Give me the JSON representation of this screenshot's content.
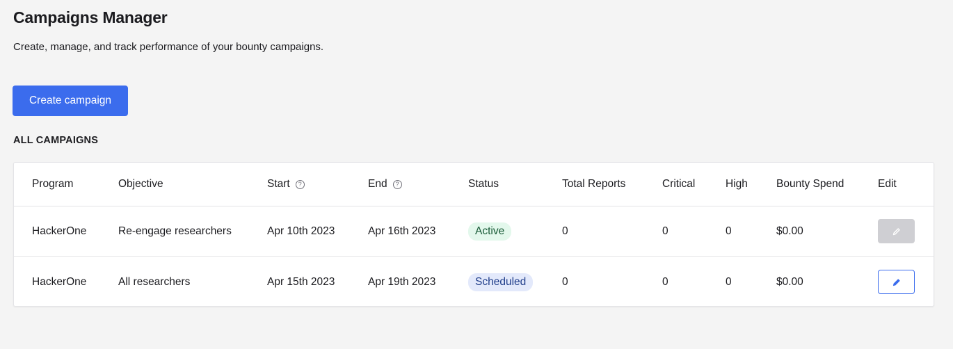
{
  "page": {
    "title": "Campaigns Manager",
    "subtitle": "Create, manage, and track performance of your bounty campaigns.",
    "create_button_label": "Create campaign",
    "section_heading": "ALL CAMPAIGNS"
  },
  "table": {
    "columns": {
      "program": "Program",
      "objective": "Objective",
      "start": "Start",
      "end": "End",
      "status": "Status",
      "total_reports": "Total Reports",
      "critical": "Critical",
      "high": "High",
      "bounty_spend": "Bounty Spend",
      "edit": "Edit"
    },
    "help_icon_glyph": "?",
    "rows": [
      {
        "program": "HackerOne",
        "objective": "Re-engage researchers",
        "start": "Apr 10th 2023",
        "end": "Apr 16th 2023",
        "status": "Active",
        "total_reports": "0",
        "critical": "0",
        "high": "0",
        "bounty_spend": "$0.00",
        "edit_enabled": false
      },
      {
        "program": "HackerOne",
        "objective": "All researchers",
        "start": "Apr 15th 2023",
        "end": "Apr 19th 2023",
        "status": "Scheduled",
        "total_reports": "0",
        "critical": "0",
        "high": "0",
        "bounty_spend": "$0.00",
        "edit_enabled": true
      }
    ]
  },
  "colors": {
    "accent": "#3b6ced",
    "background": "#f4f4f4",
    "active_badge_bg": "#e3f8ec",
    "scheduled_badge_bg": "#e3e9fb",
    "disabled_button": "#cfcfd3"
  },
  "icons": {
    "edit": "pencil-icon",
    "help": "help-circle-icon"
  }
}
